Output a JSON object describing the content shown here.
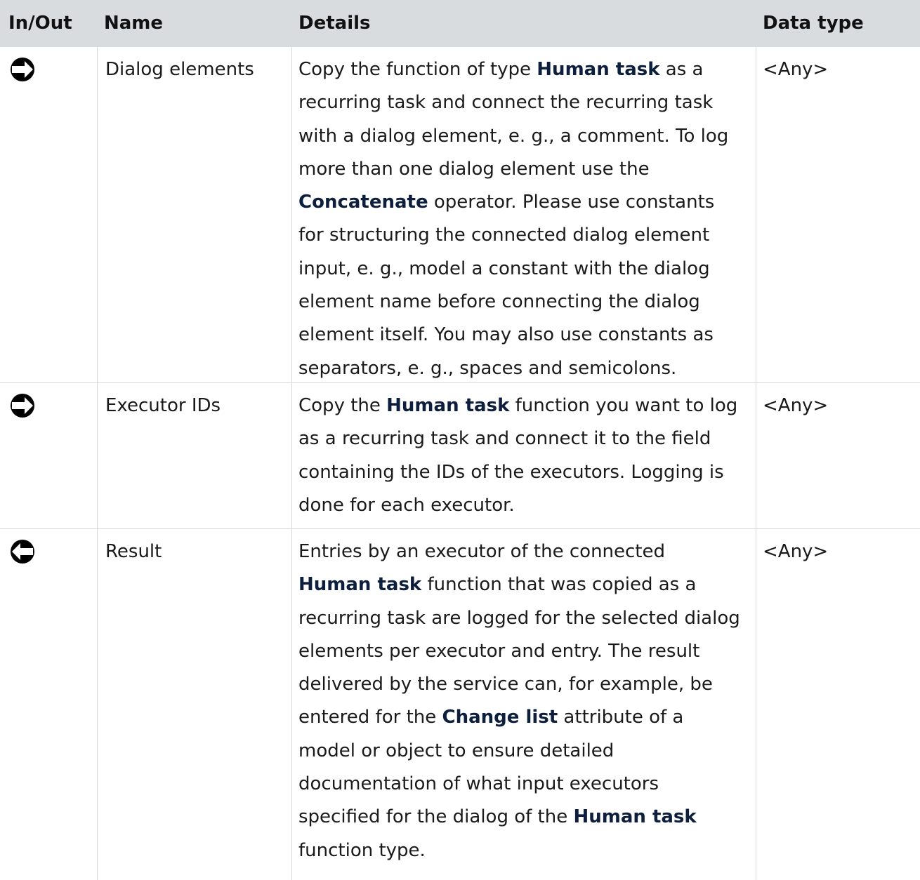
{
  "headers": {
    "in_out": "In/Out",
    "name": "Name",
    "details": "Details",
    "data_type": "Data type"
  },
  "rows": [
    {
      "direction": "in",
      "direction_icon": "arrow-right-circle-icon",
      "name": "Dialog elements",
      "details": [
        {
          "text": "Copy the function of type ",
          "bold": false
        },
        {
          "text": "Human task",
          "bold": true
        },
        {
          "text": " as a recurring task and connect the recurring task with a dialog element, e. g., a comment. To log more than one dialog element use the ",
          "bold": false
        },
        {
          "text": "Concatenate",
          "bold": true
        },
        {
          "text": " operator. Please use constants for structuring the connected dialog element input, e. g., model a constant with the dialog element name before connecting the dialog element itself. You may also use constants as separators, e. g., spaces and semicolons.",
          "bold": false
        }
      ],
      "data_type": "<Any>"
    },
    {
      "direction": "in",
      "direction_icon": "arrow-right-circle-icon",
      "name": "Executor IDs",
      "details": [
        {
          "text": "Copy the ",
          "bold": false
        },
        {
          "text": "Human task",
          "bold": true
        },
        {
          "text": " function you want to log as a recurring task and connect it to the field containing the IDs of the executors. Logging is done for each executor.",
          "bold": false
        }
      ],
      "data_type": "<Any>"
    },
    {
      "direction": "out",
      "direction_icon": "arrow-left-circle-icon",
      "name": "Result",
      "details": [
        {
          "text": "Entries by an executor of the connected ",
          "bold": false
        },
        {
          "text": "Human task",
          "bold": true
        },
        {
          "text": " function that was copied as a recurring task are logged for the selected dialog elements per executor and entry. The result delivered by the service can, for example, be entered for the ",
          "bold": false
        },
        {
          "text": "Change list",
          "bold": true
        },
        {
          "text": " attribute of a model or object to ensure detailed documentation of what input executors specified for the dialog of the ",
          "bold": false
        },
        {
          "text": "Human task",
          "bold": true
        },
        {
          "text": " function type.",
          "bold": false
        }
      ],
      "data_type": "<Any>"
    }
  ],
  "colors": {
    "header_bg": "#d8dcdf",
    "grid_line": "#d6d9dc",
    "bold_text": "#0d1f3c",
    "icon": "#000000"
  }
}
